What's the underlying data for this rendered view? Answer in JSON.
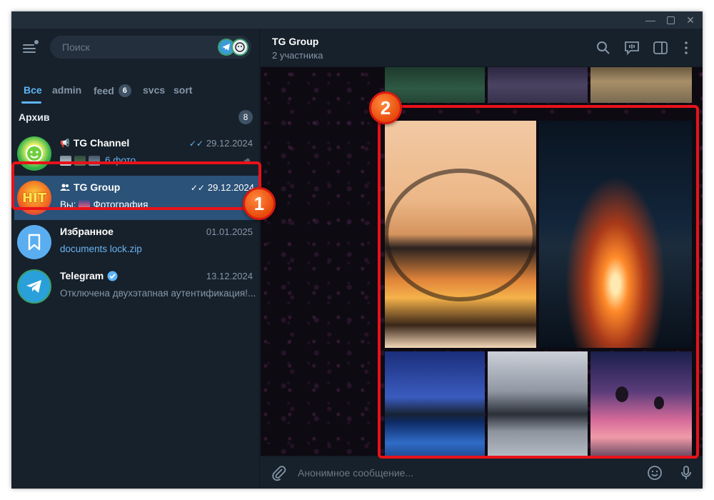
{
  "window": {
    "minimize_icon": "minimize-icon",
    "maximize_icon": "maximize-icon",
    "close_icon": "close-icon"
  },
  "sidebar": {
    "search_placeholder": "Поиск",
    "tabs": [
      {
        "label": "Все",
        "active": true
      },
      {
        "label": "admin"
      },
      {
        "label": "feed",
        "badge": "6"
      },
      {
        "label": "svcs"
      },
      {
        "label": "sort"
      }
    ],
    "archive": {
      "label": "Архив",
      "count": "8"
    },
    "chats": [
      {
        "name": "TG Channel",
        "date": "29.12.2024",
        "preview": "6 фото",
        "pinned": true
      },
      {
        "name": "TG Group",
        "date": "29.12.2024",
        "preview": "Вы:",
        "preview_text": "Фотография",
        "avatar_text": "HIT",
        "selected": true
      },
      {
        "name": "Избранное",
        "date": "01.01.2025",
        "preview": "documents lock.zip"
      },
      {
        "name": "Telegram",
        "date": "13.12.2024",
        "preview": "Отключена двухэтапная аутентификация!..."
      }
    ]
  },
  "chat_header": {
    "title": "TG Group",
    "subtitle": "2 участника"
  },
  "composer": {
    "placeholder": "Анонимное сообщение..."
  },
  "callouts": {
    "one": "1",
    "two": "2"
  },
  "colors": {
    "accent": "#5eb5f7",
    "selected": "#2b5278",
    "callout": "#e8121a",
    "background": "#17212b"
  }
}
